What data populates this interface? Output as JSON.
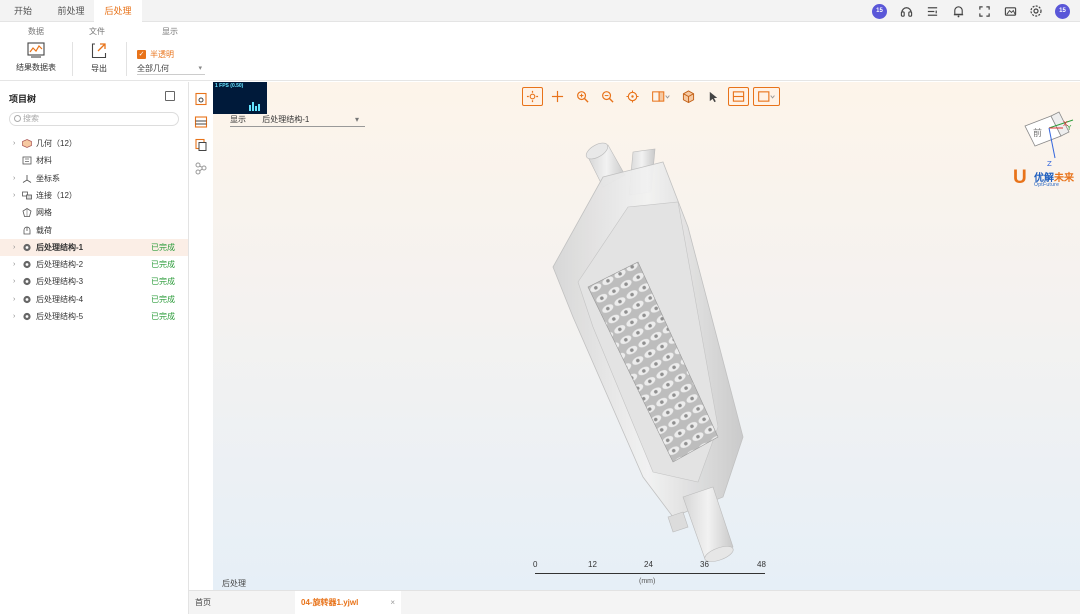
{
  "menu": {
    "tabs": [
      "开始",
      "前处理",
      "后处理"
    ],
    "active_index": 2
  },
  "topbar": {
    "avatar_left": "15",
    "avatar_right": "15",
    "icons": [
      "headset-icon",
      "list-icon",
      "bell-icon",
      "fullscreen-icon",
      "screenshot-icon",
      "gear-icon"
    ]
  },
  "ribbon": {
    "groups": [
      "数据",
      "文件",
      "显示"
    ],
    "result_table_label": "结果数据表",
    "export_label": "导出",
    "checkbox_label": "半透明",
    "checkbox_checked": true,
    "select_value": "全部几何"
  },
  "sidebar": {
    "title": "项目树",
    "search_placeholder": "搜索",
    "items": [
      {
        "label": "几何（12）",
        "status": "",
        "expandable": true
      },
      {
        "label": "材料",
        "status": "",
        "expandable": false
      },
      {
        "label": "坐标系",
        "status": "",
        "expandable": true
      },
      {
        "label": "连接（12）",
        "status": "",
        "expandable": true
      },
      {
        "label": "网格",
        "status": "",
        "expandable": false
      },
      {
        "label": "载荷",
        "status": "",
        "expandable": false
      },
      {
        "label": "后处理结构-1",
        "status": "已完成",
        "expandable": true
      },
      {
        "label": "后处理结构-2",
        "status": "已完成",
        "expandable": true
      },
      {
        "label": "后处理结构-3",
        "status": "已完成",
        "expandable": true
      },
      {
        "label": "后处理结构-4",
        "status": "已完成",
        "expandable": true
      },
      {
        "label": "后处理结构-5",
        "status": "已完成",
        "expandable": true
      }
    ],
    "selected_index": 6
  },
  "viewport": {
    "fps": "1 FPS (0.50)",
    "select_label": "显示",
    "select_value": "后处理结构-1",
    "scale_ticks": [
      "0",
      "12",
      "24",
      "36",
      "48"
    ],
    "scale_unit": "(mm)",
    "bottom_label": "后处理",
    "axis_labels": {
      "x": "X",
      "y": "Y",
      "z": "Z"
    },
    "cube_face": "前",
    "logo_cn_1": "优",
    "logo_cn_2": "解",
    "logo_cn_3": "未来",
    "logo_en": "OptFuture",
    "accent_color": "#e8731a"
  },
  "bottom_tabs": [
    {
      "label": "首页",
      "active": false
    },
    {
      "label": "04-旋转器1.yjwl",
      "active": true
    }
  ]
}
